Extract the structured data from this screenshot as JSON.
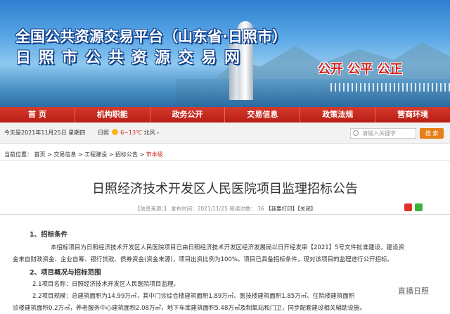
{
  "banner": {
    "line1": "全国公共资源交易平台（山东省·日照市）",
    "line2": "日照市公共资源交易网",
    "slogan": "公开 公平 公正"
  },
  "nav": [
    "首 页",
    "机构职能",
    "政务公开",
    "交易信息",
    "政策法规",
    "营商环境"
  ],
  "info": {
    "date": "今天是2021年11月25日 星期四",
    "city": "日照",
    "temp": "6~13℃",
    "wind": "北风",
    "search_placeholder": "请输入关键字",
    "search_button": "搜 索"
  },
  "breadcrumb": {
    "prefix": "当前位置：",
    "items": [
      "首页",
      "交易信息",
      "工程建设",
      "招标公告"
    ],
    "current": "市本级"
  },
  "article": {
    "title": "日照经济技术开发区人民医院项目监理招标公告",
    "meta": {
      "publisher": "【信息来源：",
      "date_text": "】  发布时间：2021/11/25  阅读次数：",
      "views": "36",
      "print": "【我要打印】",
      "close": "【关闭】"
    },
    "h1": "1、招标条件",
    "p1a": "本招标项目为日照经济技术开发区人民医院项目已由日照经济技术开发区经济发展局以日开经发审【2021】5号文件批准建设，建设资",
    "p1b": "金来自财政资金、企业自筹、银行贷款、债券资金(资金来源)，项目出资比例为100%。项目已具备招标条件，现对该项目的监理进行公开招标。",
    "h2": "2、项目概况与招标范围",
    "p21": "2.1项目名称：日照经济技术开发区人民医院项目监理。",
    "p22a": "2.2项目规模：总建筑面积为14.99万㎡，其中门诊综合楼建筑面积1.89万㎡、医技楼建筑面积1.85万㎡、住院楼建筑面积",
    "p22b": "诊楼建筑面积0.2万㎡，养老服务中心建筑面积2.08万㎡，地下车库建筑面积5.48万㎡及制氧站和门卫，同步配套建设相关辅助设施。"
  },
  "watermark": "直播日照"
}
